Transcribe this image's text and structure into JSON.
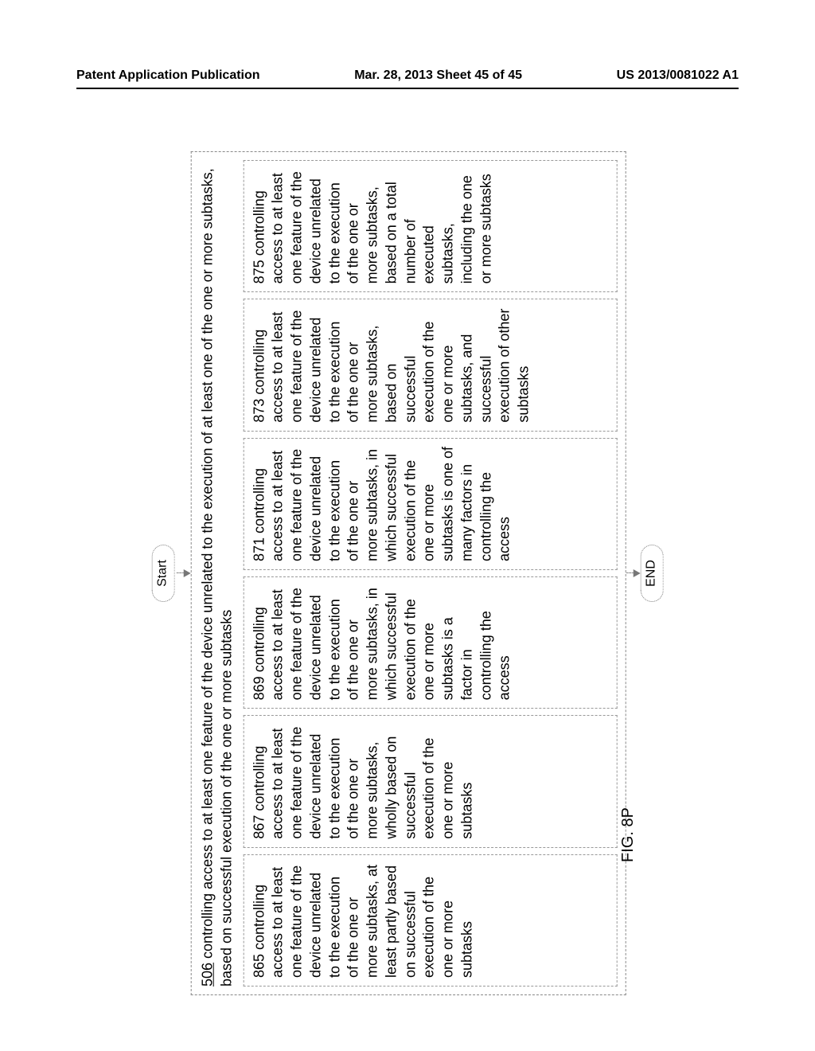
{
  "header": {
    "left": "Patent Application Publication",
    "mid": "Mar. 28, 2013  Sheet 45 of 45",
    "right": "US 2013/0081022 A1"
  },
  "flow": {
    "start": "Start",
    "end": "END"
  },
  "outer": {
    "num": "506",
    "text": " controlling access to at least one feature of the device unrelated to the execution of at least one of the one or more subtasks, based on successful execution of the one or more subtasks"
  },
  "cells": [
    "865 controlling access to at least one feature of the device unrelated to the execution of the one or more subtasks, at least partly based on successful execution of the one or more subtasks",
    "867 controlling access to at least one feature of the device unrelated to the execution of the one or more subtasks, wholly based on successful execution of the one or more subtasks",
    "869 controlling access to at least one feature of the device unrelated to the execution of the one or more subtasks, in which successful execution of the one or more subtasks is a factor in controlling the access",
    "871 controlling access to at least one feature of the device unrelated to the execution of the one or more subtasks, in which successful execution of the one or more subtasks is one of many factors in controlling the access",
    "873 controlling access to at least one feature of the device unrelated to the execution of the one or more subtasks, based on successful execution of the one or more subtasks, and successful execution of other subtasks",
    "875 controlling access to at least one feature of the device unrelated to the execution of the one or more subtasks, based on a total number of executed subtasks, including the one or more subtasks"
  ],
  "fig": "FIG. 8P"
}
